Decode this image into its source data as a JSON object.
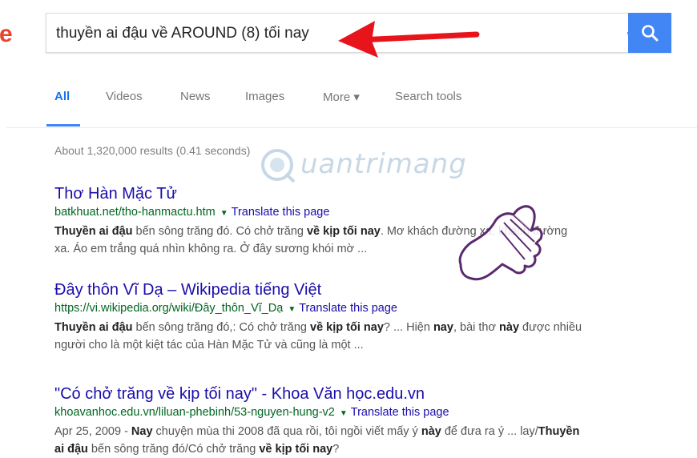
{
  "logo": {
    "letter": "e"
  },
  "search": {
    "value": "thuyền ai đậu về AROUND (8) tối nay"
  },
  "tabs": [
    {
      "label": "All"
    },
    {
      "label": "Videos"
    },
    {
      "label": "News"
    },
    {
      "label": "Images"
    },
    {
      "label": "More ▾"
    },
    {
      "label": "Search tools"
    }
  ],
  "stats": "About 1,320,000 results (0.41 seconds)",
  "watermark": "uantrimang",
  "translate_label": "Translate this page",
  "results": [
    {
      "title": "Thơ Hàn Mặc Tử",
      "url": "batkhuat.net/tho-hanmactu.htm",
      "snippet_line1_parts": [
        "Thuyền ai đậu",
        " bến sông trăng đó. Có chở trăng ",
        "về kịp tối nay",
        ". Mơ khách đường xa, khách đường"
      ],
      "snippet_line2": "xa. Áo em trắng quá nhìn không ra. Ở đây sương khói mờ ..."
    },
    {
      "title": "Đây thôn Vĩ Dạ – Wikipedia tiếng Việt",
      "url": "https://vi.wikipedia.org/wiki/Đây_thôn_Vĩ_Dạ",
      "snippet_line1_parts": [
        "Thuyền ai đậu",
        " bến sông trăng đó,: Có chở trăng ",
        "về kịp tối nay",
        "? ... Hiện ",
        "nay",
        ", bài thơ ",
        "này",
        " được nhiều"
      ],
      "snippet_line2": "người cho là một kiệt tác của Hàn Mặc Tử và cũng là một ..."
    },
    {
      "title": "\"Có chở trăng về kịp tối nay\" - Khoa Văn học.edu.vn",
      "url": "khoavanhoc.edu.vn/liluan-phebinh/53-nguyen-hung-v2",
      "snippet_line1_parts": [
        "Apr 25, 2009 - ",
        "Nay",
        " chuyện mùa thi 2008 đã qua rồi, tôi ngồi viết mấy ý ",
        "này",
        " để đưa ra ý ... lay/",
        "Thuyền"
      ],
      "snippet_line2_parts": [
        "ai đậu",
        " bến sông trăng đó/Có chở trăng ",
        "về kịp tối nay",
        "?"
      ]
    }
  ]
}
